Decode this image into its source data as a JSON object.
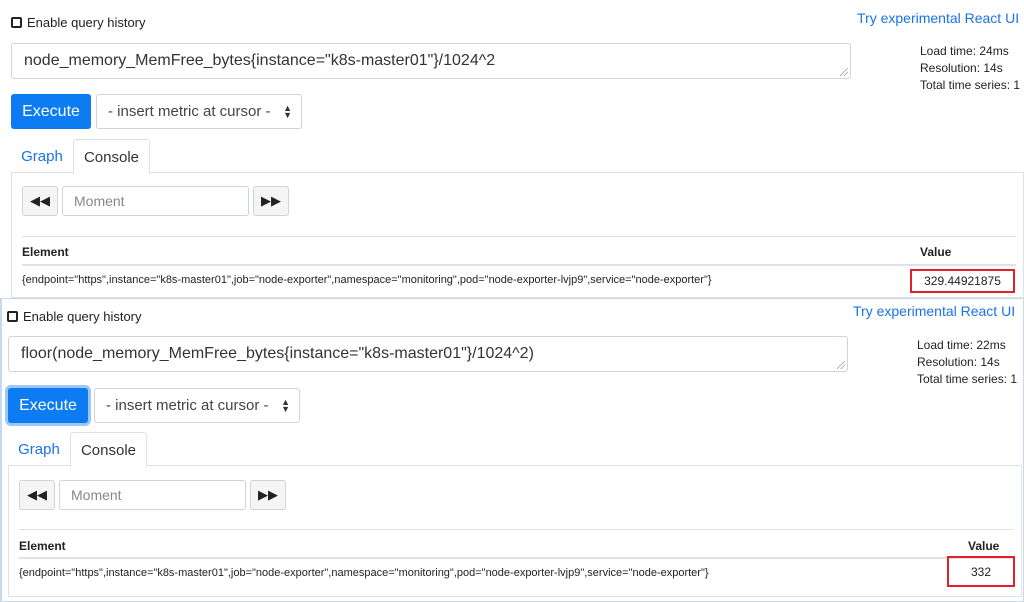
{
  "top": {
    "enable_history_label": "Enable query history",
    "react_link": "Try experimental React UI",
    "expression": "node_memory_MemFree_bytes{instance=\"k8s-master01\"}/1024^2",
    "stats": {
      "load_time": "Load time: 24ms",
      "resolution": "Resolution: 14s",
      "total_series": "Total time series: 1"
    },
    "execute_label": "Execute",
    "metric_select": "- insert metric at cursor -",
    "tabs": {
      "graph": "Graph",
      "console": "Console"
    },
    "moment_placeholder": "Moment",
    "table": {
      "col_element": "Element",
      "col_value": "Value",
      "row_element": "{endpoint=\"https\",instance=\"k8s-master01\",job=\"node-exporter\",namespace=\"monitoring\",pod=\"node-exporter-lvjp9\",service=\"node-exporter\"}",
      "row_value": "329.44921875"
    }
  },
  "bottom": {
    "enable_history_label": "Enable query history",
    "react_link": "Try experimental React UI",
    "expression": "floor(node_memory_MemFree_bytes{instance=\"k8s-master01\"}/1024^2)",
    "stats": {
      "load_time": "Load time: 22ms",
      "resolution": "Resolution: 14s",
      "total_series": "Total time series: 1"
    },
    "execute_label": "Execute",
    "metric_select": "- insert metric at cursor -",
    "tabs": {
      "graph": "Graph",
      "console": "Console"
    },
    "moment_placeholder": "Moment",
    "table": {
      "col_element": "Element",
      "col_value": "Value",
      "row_element": "{endpoint=\"https\",instance=\"k8s-master01\",job=\"node-exporter\",namespace=\"monitoring\",pod=\"node-exporter-lvjp9\",service=\"node-exporter\"}",
      "row_value": "332"
    }
  },
  "icons": {
    "rewind": "rewind-icon",
    "fast_forward": "fast-forward-icon",
    "select_arrows": "updown-arrows-icon"
  },
  "colors": {
    "accent": "#0d7cf2",
    "highlight_box": "#e0202a",
    "link": "#1a73e8"
  }
}
